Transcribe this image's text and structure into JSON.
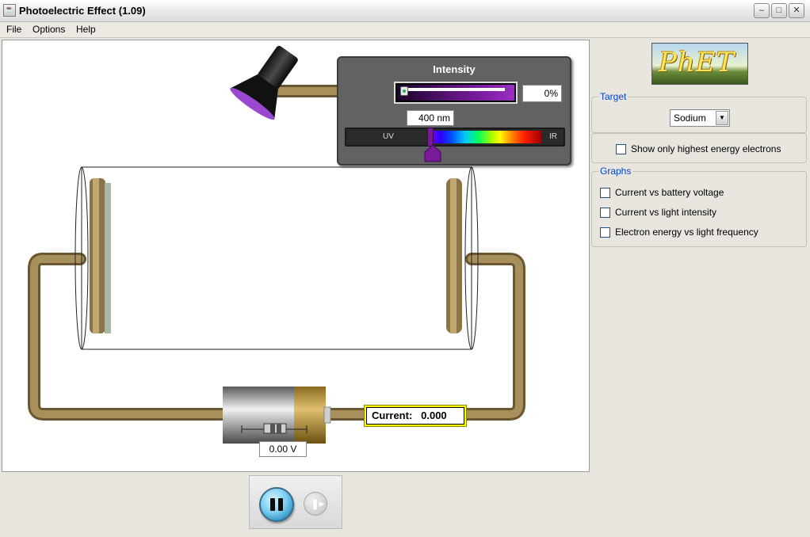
{
  "window": {
    "title": "Photoelectric Effect (1.09)"
  },
  "menu": {
    "items": [
      "File",
      "Options",
      "Help"
    ]
  },
  "light_control": {
    "title": "Intensity",
    "intensity_value": "0%",
    "intensity_fraction": 0,
    "wavelength": "400 nm",
    "uv_label": "UV",
    "ir_label": "IR"
  },
  "circuit": {
    "battery_voltage": "0.00 V",
    "current_label": "Current:",
    "current_value": "0.000"
  },
  "side_panel": {
    "logo_text": "PhET",
    "target": {
      "title": "Target",
      "selected": "Sodium"
    },
    "options": {
      "show_highest_energy_label": "Show only highest energy electrons",
      "show_highest_energy_checked": false
    },
    "graphs": {
      "title": "Graphs",
      "items": [
        {
          "label": "Current vs battery voltage",
          "checked": false
        },
        {
          "label": "Current vs light intensity",
          "checked": false
        },
        {
          "label": "Electron energy vs light frequency",
          "checked": false
        }
      ]
    }
  },
  "colors": {
    "wire": "#a08a5a",
    "current_border": "#ffff00",
    "group_title": "#0046d5",
    "light_beam": "#9a48d0"
  },
  "icons": [
    "java-app-icon",
    "minimize-icon",
    "maximize-icon",
    "close-icon",
    "pause-icon",
    "step-icon",
    "dropdown-arrow-icon"
  ]
}
